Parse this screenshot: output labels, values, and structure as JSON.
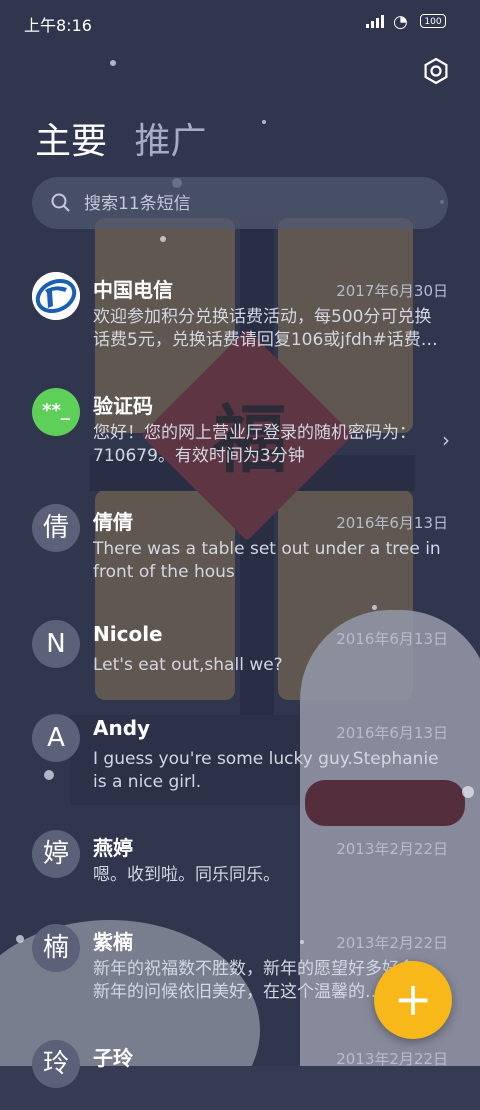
{
  "status_bar": {
    "time": "上午8:16",
    "battery": "100"
  },
  "tabs": [
    {
      "label": "主要"
    },
    {
      "label": "推广"
    }
  ],
  "search": {
    "placeholder": "搜索11条短信"
  },
  "conversations": [
    {
      "name": "中国电信",
      "date": "2017年6月30日",
      "avatar": "",
      "avatar_type": "telecom-logo-icon",
      "message": "欢迎参加积分兑换话费活动，每500分可兑换话费5元，兑换话费请回复106或jfdh#话费…"
    },
    {
      "name": "验证码",
      "date": "",
      "avatar": "**_",
      "avatar_type": "code",
      "message": "您好！您的网上营业厅登录的随机密码为：710679。有效时间为3分钟"
    },
    {
      "name": "倩倩",
      "date": "2016年6月13日",
      "avatar": "倩",
      "message": "There was a table set out under a tree in front of the hous"
    },
    {
      "name": "Nicole",
      "date": "2016年6月13日",
      "avatar": "N",
      "message": "Let's eat out,shall we?"
    },
    {
      "name": "Andy",
      "date": "2016年6月13日",
      "avatar": "A",
      "message": "I guess you're some lucky guy.Stephanie is a nice girl."
    },
    {
      "name": "燕婷",
      "date": "2013年2月22日",
      "avatar": "婷",
      "message": "嗯。收到啦。同乐同乐。"
    },
    {
      "name": "紫楠",
      "date": "2013年2月22日",
      "avatar": "楠",
      "message": "新年的祝福数不胜数，新年的愿望好多好多，新年的问候依旧美好，在这个温馨的…"
    },
    {
      "name": "子玲",
      "date": "2013年2月22日",
      "avatar": "玲",
      "message": ""
    }
  ],
  "background_art": {
    "character": "福"
  },
  "fab": {
    "label": "+",
    "color": "#f8b81a"
  },
  "icons": {
    "settings": "gear-icon",
    "search": "search-icon",
    "chevron": "chevron-right-icon"
  }
}
